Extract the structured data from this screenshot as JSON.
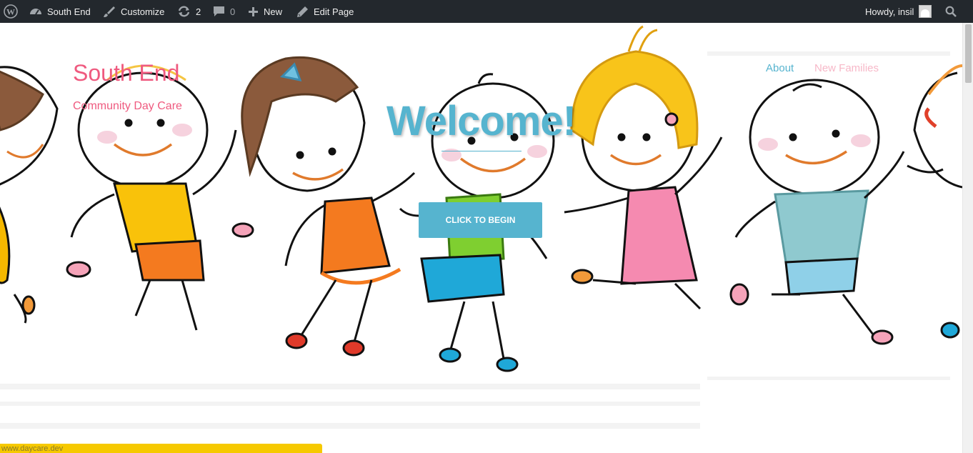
{
  "admin_bar": {
    "site_name": "South End",
    "customize": "Customize",
    "updates_count": "2",
    "comments_count": "0",
    "new_label": "New",
    "edit_label": "Edit Page",
    "greeting": "Howdy, insil"
  },
  "site": {
    "title": "South End",
    "tagline": "Community Day Care"
  },
  "nav": {
    "items": [
      {
        "label": "About",
        "color": "#56b4cf"
      },
      {
        "label": "New Families",
        "color": "#f7b8c8"
      }
    ]
  },
  "hero": {
    "heading": "Welcome!",
    "button_label": "CLICK TO BEGIN"
  },
  "status_bar": {
    "url": "www.daycare.dev"
  },
  "colors": {
    "admin_bar_bg": "#23282d",
    "brand_pink": "#ef5a7f",
    "accent_blue": "#56b4cf",
    "status_yellow": "#f6c900"
  },
  "icons": [
    "wordpress-logo-icon",
    "dashboard-icon",
    "brush-icon",
    "updates-icon",
    "comment-icon",
    "plus-icon",
    "pencil-icon",
    "avatar",
    "search-icon"
  ]
}
